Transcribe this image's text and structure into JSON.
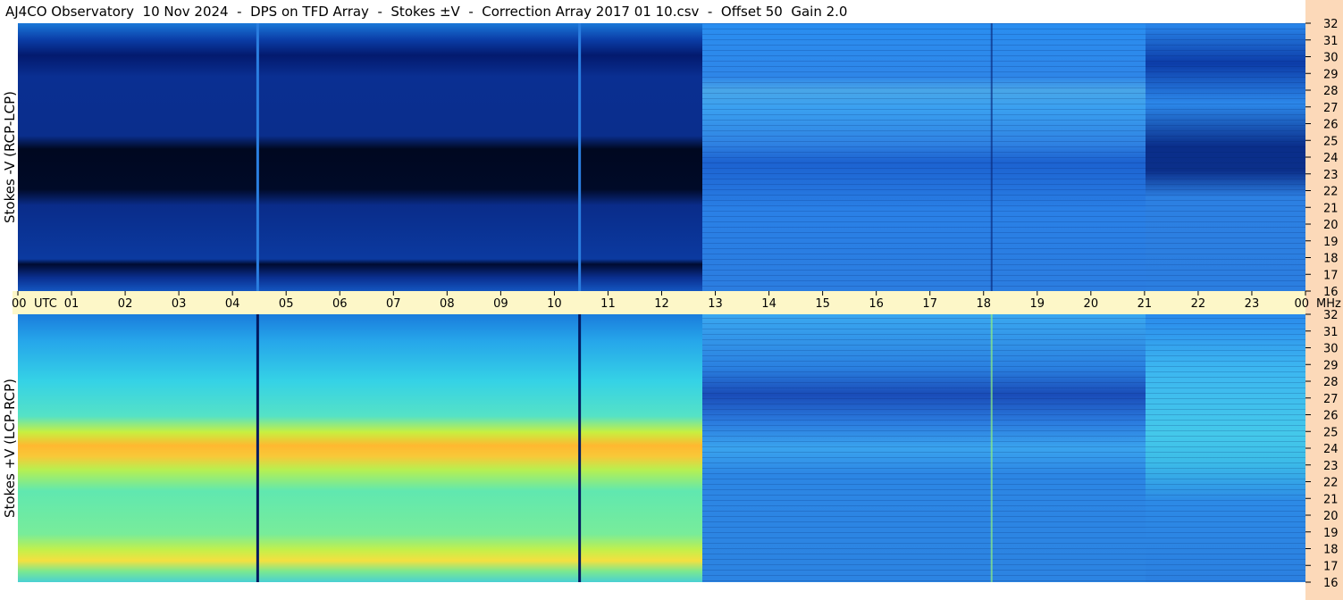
{
  "title": "AJ4CO Observatory  10 Nov 2024  -  DPS on TFD Array  -  Stokes ±V  -  Correction Array 2017 01 10.csv  -  Offset 50  Gain 2.0",
  "colors": {
    "axis_band": "#fdf7c8",
    "freq_band": "#fcd9b9",
    "background": "#ffffff"
  },
  "chart_data": [
    {
      "type": "heatmap",
      "ylabel": "Stokes -V (RCP-LCP)",
      "x_unit": "UTC",
      "y_unit": "MHz",
      "xlim": [
        0,
        24
      ],
      "ylim": [
        16,
        32
      ],
      "x_ticks": [
        "00",
        "01",
        "02",
        "03",
        "04",
        "05",
        "06",
        "07",
        "08",
        "09",
        "10",
        "11",
        "12",
        "13",
        "14",
        "15",
        "16",
        "17",
        "18",
        "19",
        "20",
        "21",
        "22",
        "23",
        "00"
      ],
      "y_ticks": [
        "16",
        "17",
        "18",
        "19",
        "20",
        "21",
        "22",
        "23",
        "24",
        "25",
        "26",
        "27",
        "28",
        "29",
        "30",
        "31",
        "32"
      ],
      "features": {
        "dark_band_mhz": [
          22.5,
          25.5
        ],
        "dark_band_until_utc": 12.7,
        "receiver_off_gaps_utc": [
          4.47,
          10.47
        ],
        "activity_start_utc": 12.7,
        "interference_line_utc": 18.15,
        "second_segment_start_utc": 21.0
      }
    },
    {
      "type": "heatmap",
      "ylabel": "Stokes +V (LCP-RCP)",
      "x_unit": "UTC",
      "y_unit": "MHz",
      "xlim": [
        0,
        24
      ],
      "ylim": [
        16,
        32
      ],
      "y_ticks": [
        "16",
        "17",
        "18",
        "19",
        "20",
        "21",
        "22",
        "23",
        "24",
        "25",
        "26",
        "27",
        "28",
        "29",
        "30",
        "31",
        "32"
      ],
      "features": {
        "bright_band_mhz": [
          22.5,
          25.5
        ],
        "bright_band_until_utc": 12.7,
        "receiver_off_gaps_utc": [
          4.47,
          10.47
        ],
        "activity_start_utc": 12.7,
        "interference_line_utc": 18.15,
        "second_segment_start_utc": 21.0
      }
    }
  ]
}
